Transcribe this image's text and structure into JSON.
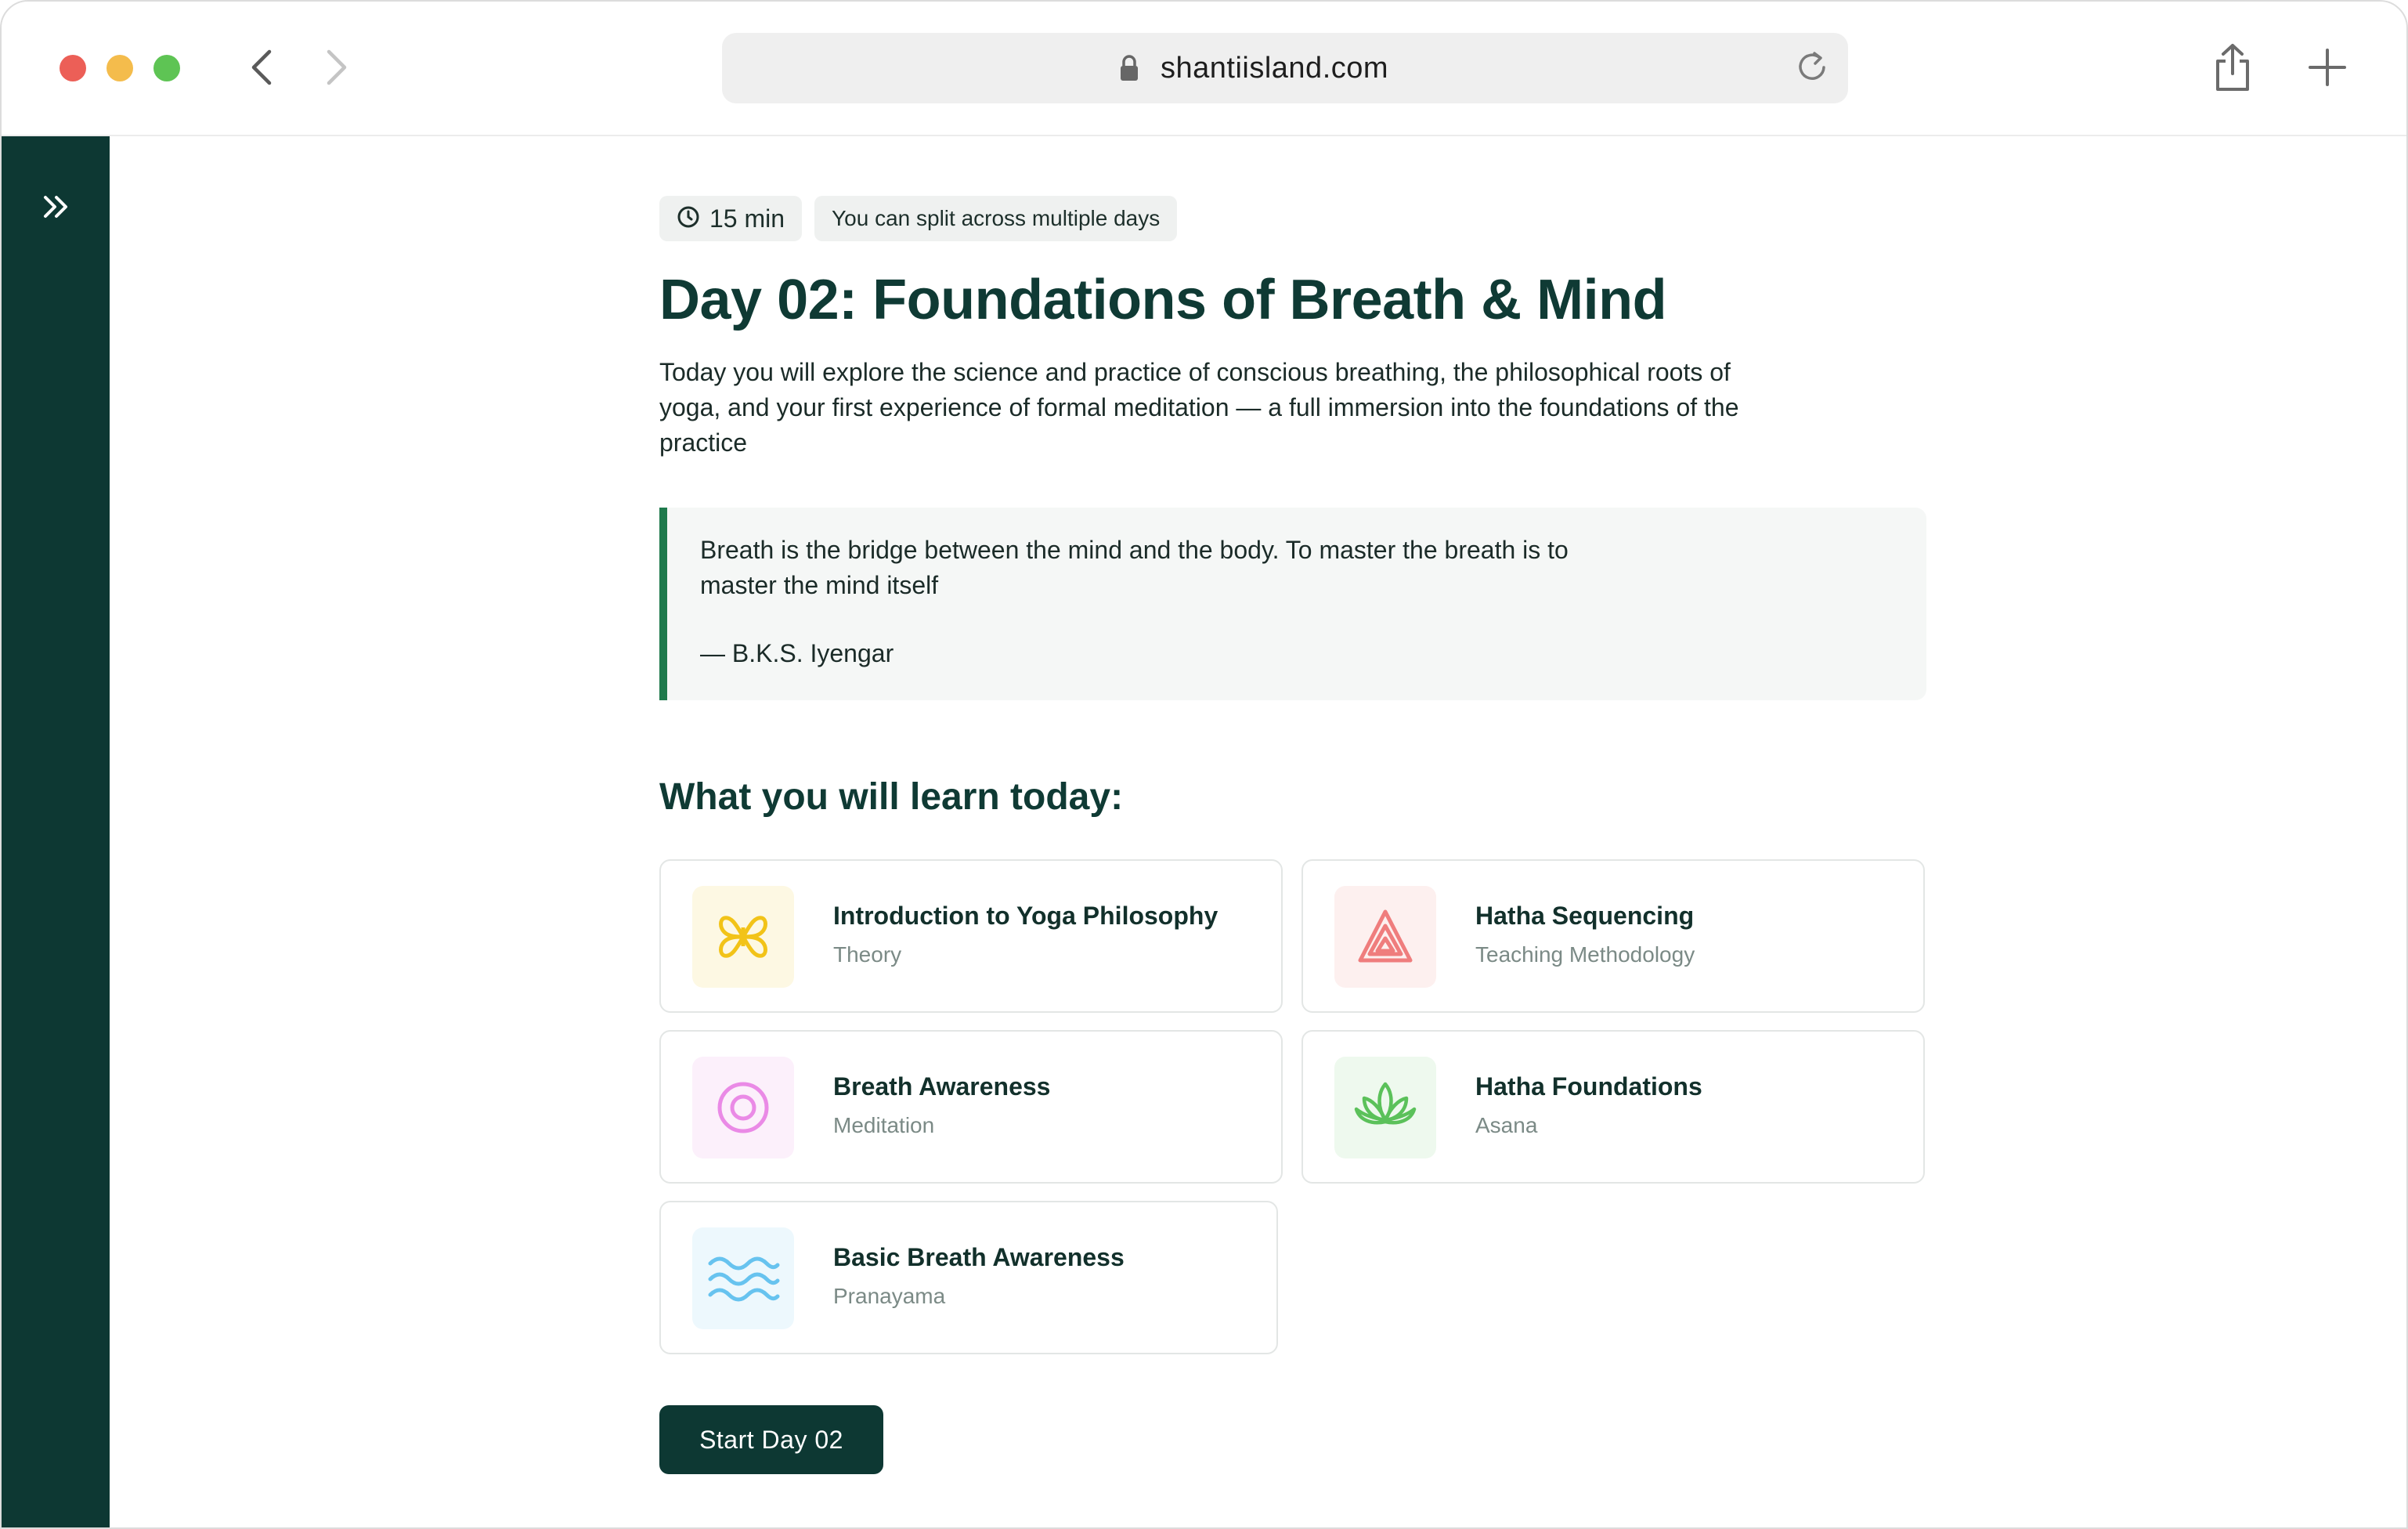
{
  "browser": {
    "url": "shantiisland.com",
    "traffic_light_colors": [
      "#ec5f57",
      "#f4bc4c",
      "#5ec454"
    ]
  },
  "lesson": {
    "duration": "15 min",
    "split_note": "You can split across multiple days",
    "title": "Day 02: Foundations of Breath & Mind",
    "intro": "Today you will explore the science and practice of conscious breathing, the philosophical roots of yoga, and your first experience of formal meditation — a full immersion into the foundations of the practice",
    "quote": {
      "text": "Breath is the bridge between the mind and the body. To master the breath is to master the mind itself",
      "author": "— B.K.S. Iyengar"
    },
    "section_heading": "What you will learn today:",
    "topics": [
      {
        "name": "Introduction to Yoga Philosophy",
        "category": "Theory",
        "icon": "flower-icon",
        "icon_color": "#f2c318",
        "icon_bg": "#fdf8e3"
      },
      {
        "name": "Hatha Sequencing",
        "category": "Teaching Methodology",
        "icon": "triangle-icon",
        "icon_color": "#ef7d7d",
        "icon_bg": "#fdf0ef"
      },
      {
        "name": "Breath Awareness",
        "category": "Meditation",
        "icon": "circle-target-icon",
        "icon_color": "#ea8ae6",
        "icon_bg": "#fcf0fb"
      },
      {
        "name": "Hatha Foundations",
        "category": "Asana",
        "icon": "lotus-icon",
        "icon_color": "#5bc15a",
        "icon_bg": "#eef9ee"
      },
      {
        "name": "Basic Breath Awareness",
        "category": "Pranayama",
        "icon": "waves-icon",
        "icon_color": "#67c3ef",
        "icon_bg": "#edf8fd"
      }
    ],
    "start_button": "Start Day 02"
  },
  "colors": {
    "sidebar": "#0d3833",
    "heading": "#0f3a34",
    "quote_accent": "#1f7a4c"
  }
}
